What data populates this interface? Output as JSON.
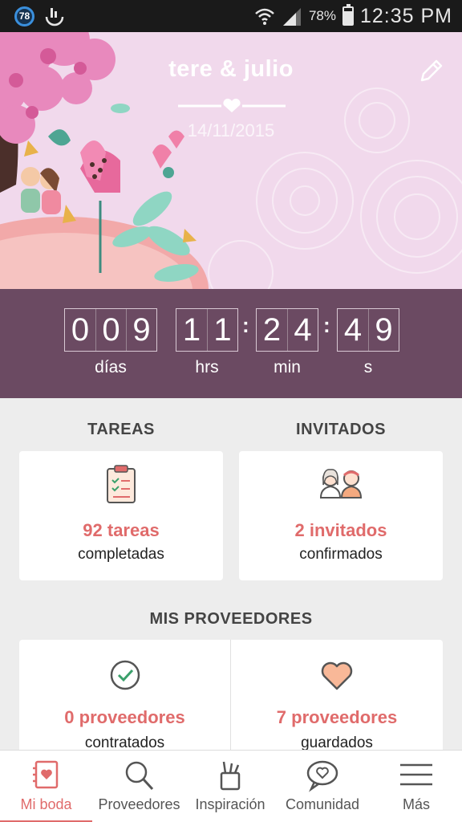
{
  "status_bar": {
    "notification_count": "78",
    "battery_percent": "78%",
    "battery_level": 0.78,
    "time": "12:35 PM"
  },
  "header": {
    "couple_names": "tere & julio",
    "wedding_date": "14/11/2015"
  },
  "countdown": {
    "days": [
      "0",
      "0",
      "9"
    ],
    "hours": [
      "1",
      "1"
    ],
    "minutes": [
      "2",
      "4"
    ],
    "seconds": [
      "4",
      "9"
    ],
    "days_label": "días",
    "hours_label": "hrs",
    "minutes_label": "min",
    "seconds_label": "s"
  },
  "tareas": {
    "title": "TAREAS",
    "count": "92 tareas",
    "sub": "completadas"
  },
  "invitados": {
    "title": "INVITADOS",
    "count": "2 invitados",
    "sub": "confirmados"
  },
  "proveedores": {
    "title": "MIS PROVEEDORES",
    "contratados_count": "0 proveedores",
    "contratados_sub": "contratados",
    "guardados_count": "7 proveedores",
    "guardados_sub": "guardados"
  },
  "bottom_nav": {
    "items": [
      {
        "label": "Mi boda",
        "icon": "notebook-icon",
        "active": true
      },
      {
        "label": "Proveedores",
        "icon": "search-icon",
        "active": false
      },
      {
        "label": "Inspiración",
        "icon": "pencil-cup-icon",
        "active": false
      },
      {
        "label": "Comunidad",
        "icon": "chat-heart-icon",
        "active": false
      },
      {
        "label": "Más",
        "icon": "menu-icon",
        "active": false
      }
    ]
  },
  "colors": {
    "accent": "#e06b6b",
    "countdown_bg": "#6b4a62",
    "hero_bg": "#f1d9ec"
  }
}
